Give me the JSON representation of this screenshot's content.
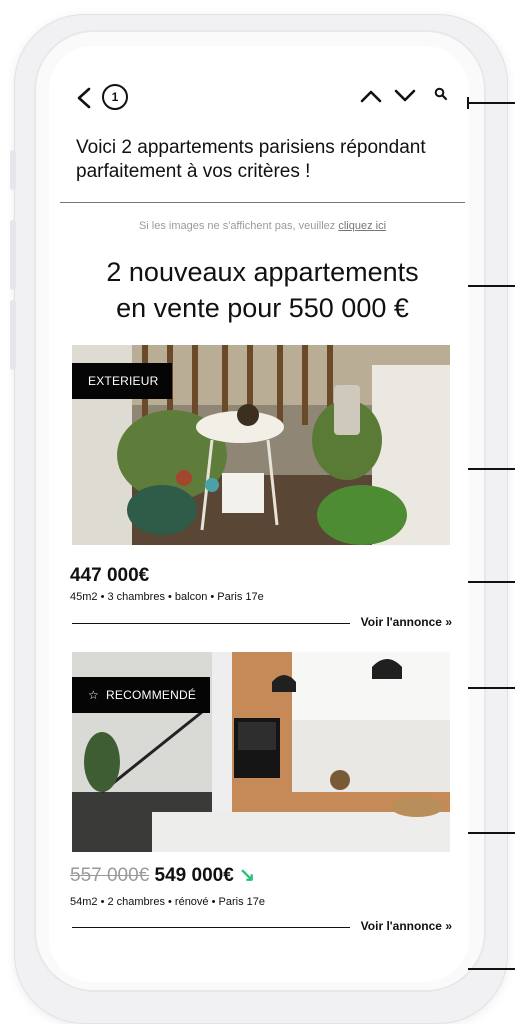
{
  "header": {
    "back_icon": "chevron-left-icon",
    "badge_count": "1",
    "up_icon": "chevron-up-icon",
    "down_icon": "chevron-down-icon",
    "search_icon": "search-icon"
  },
  "email": {
    "subject": "Voici 2 appartements parisiens répondant parfaitement à vos critères !",
    "fallback_text": "Si les images ne s'affichent pas, veuillez ",
    "fallback_link": "cliquez ici",
    "headline_line1": "2 nouveaux appartements",
    "headline_line2": "en vente pour 550 000 €"
  },
  "listings": [
    {
      "tag": "EXTERIEUR",
      "price": "447 000€",
      "details": "45m2 • 3 chambres • balcon • Paris 17e",
      "cta": "Voir l'annonce »"
    },
    {
      "tag_icon": "star-icon",
      "tag": "RECOMMENDÉ",
      "old_price": "557 000€",
      "price": "549 000€",
      "trend_icon": "arrow-down-right-icon",
      "trend_symbol": "↘",
      "details": "54m2 • 2 chambres • rénové • Paris 17e",
      "cta": "Voir l'annonce »"
    }
  ],
  "colors": {
    "accent_green": "#25c27a",
    "tag_bg": "#050505",
    "muted": "#9b9b9b"
  }
}
